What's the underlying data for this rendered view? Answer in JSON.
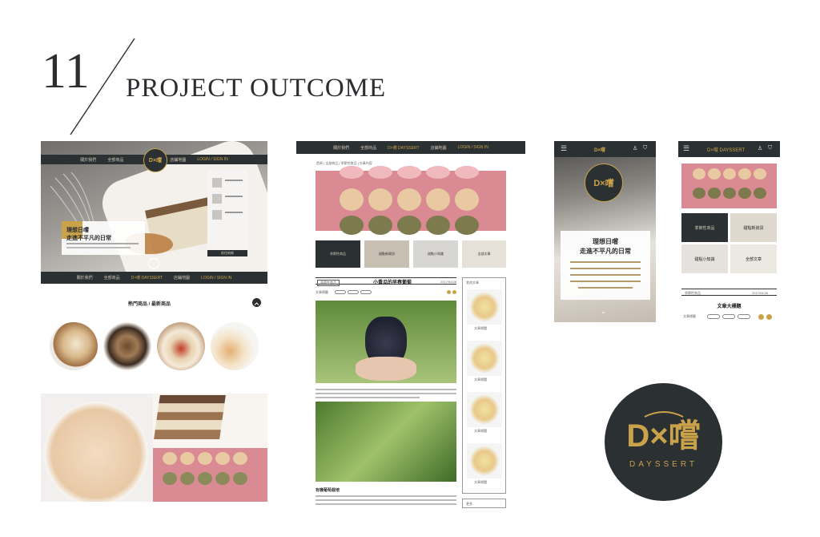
{
  "header": {
    "number": "11",
    "title": "PROJECT OUTCOME"
  },
  "colors": {
    "dark": "#2b3033",
    "gold": "#c9a24a",
    "pink": "#d98a92",
    "bg": "#ffffff"
  },
  "desktop": {
    "nav": [
      "關於我們",
      "全部商品",
      "D×嚐 DAYSSERT",
      "店鋪地圖",
      "LOGIN / SIGN IN"
    ],
    "hero": {
      "line1": "理想日嚐",
      "line2": "走進不平凡的日常"
    },
    "sidebar_button": "前往結帳",
    "footer_logo": "D×嚐 DAYSSERT",
    "products": {
      "heading": "熱門商品 / 最新商品"
    }
  },
  "article": {
    "nav_logo": "D×嚐 DAYSSERT",
    "breadcrumb": "首頁 | 全部商品 | 季節性商品 | 文章內容",
    "cards": [
      "季節性商品",
      "甜點新資訊",
      "甜點小知識",
      "全部文章"
    ],
    "tag": "季節性商品",
    "title": "小黃瓜的早春葡萄",
    "date": "2017/04/26",
    "sidebar_heading": "其他文章",
    "sidebar_items": [
      "文章標題",
      "文章標題",
      "文章標題",
      "文章標題"
    ],
    "section_heading": "有機葡萄栽培",
    "bottom_label": "更多",
    "keywords": "文章標籤"
  },
  "mobile1": {
    "logo": "D×嚐",
    "hero": {
      "line1": "理想日嚐",
      "line2": "走進不平凡的日常"
    }
  },
  "mobile2": {
    "logo": "D×嚐 DAYSSERT",
    "cards": [
      "季節性商品",
      "甜點新資訊",
      "甜點小知識",
      "全部文章"
    ],
    "tag": "季節性商品",
    "date": "2017/04/26",
    "title": "文章大標題",
    "keywords": "文章標籤"
  },
  "logo": {
    "mark": "D×嚐",
    "wordmark": "DAYSSERT"
  }
}
